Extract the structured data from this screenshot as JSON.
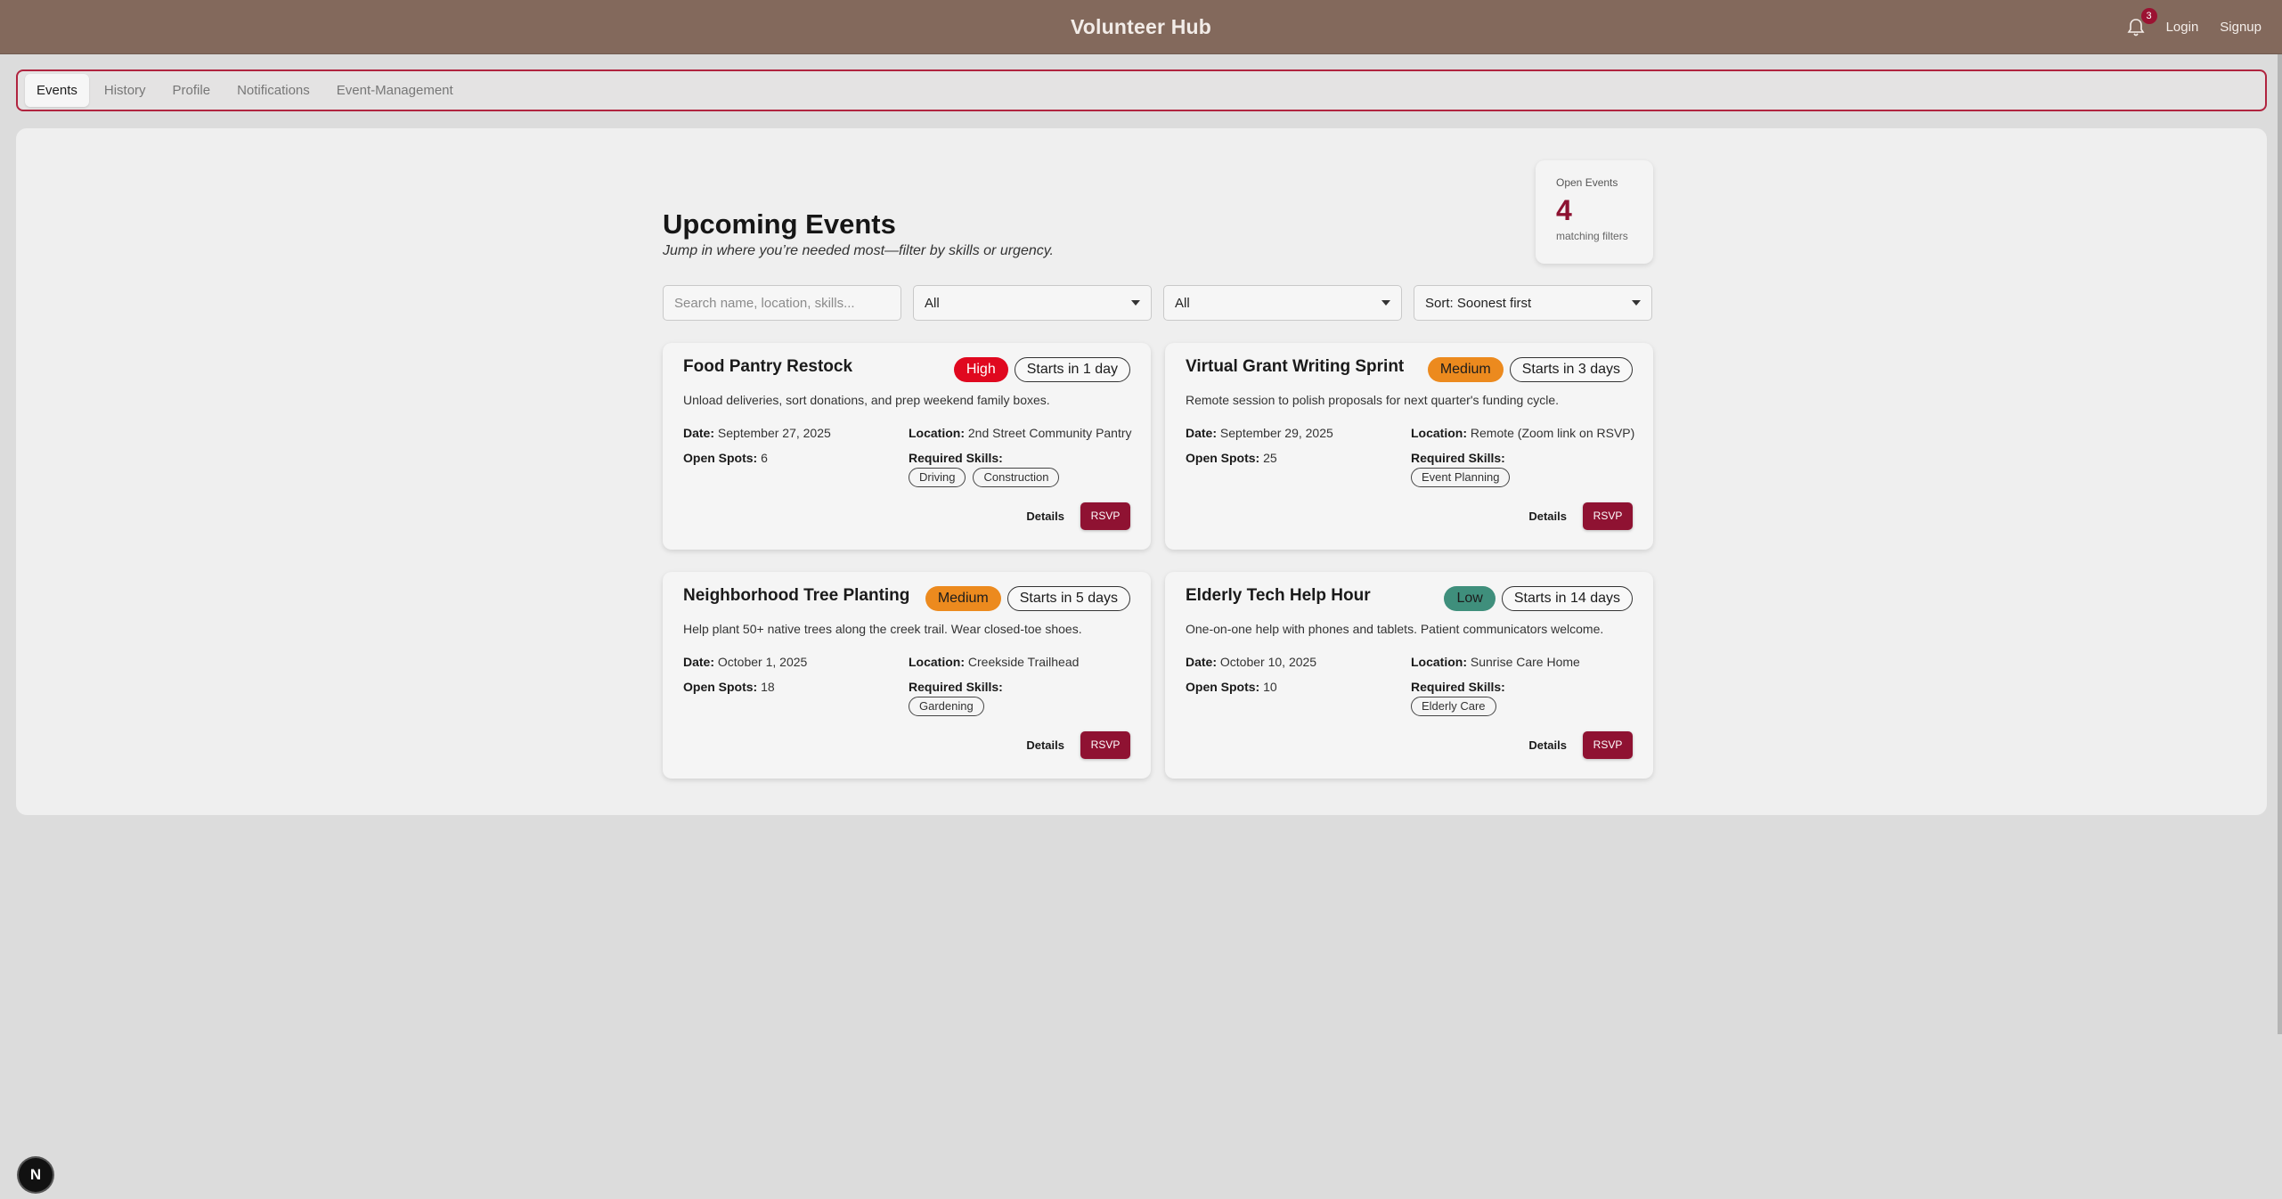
{
  "header": {
    "title": "Volunteer Hub",
    "notification_count": "3",
    "login_label": "Login",
    "signup_label": "Signup"
  },
  "tabs": [
    {
      "label": "Events",
      "active": true
    },
    {
      "label": "History",
      "active": false
    },
    {
      "label": "Profile",
      "active": false
    },
    {
      "label": "Notifications",
      "active": false
    },
    {
      "label": "Event-Management",
      "active": false
    }
  ],
  "main": {
    "title": "Upcoming Events",
    "subtitle": "Jump in where you’re needed most—filter by skills or urgency.",
    "stat": {
      "label": "Open Events",
      "value": "4",
      "sublabel": "matching filters"
    },
    "filters": {
      "search_placeholder": "Search name, location, skills...",
      "filter1_value": "All",
      "filter2_value": "All",
      "sort_value": "Sort: Soonest first"
    },
    "labels": {
      "date": "Date:",
      "location": "Location:",
      "open_spots": "Open Spots:",
      "required_skills": "Required Skills:",
      "details": "Details",
      "rsvp": "RSVP"
    },
    "events": [
      {
        "title": "Food Pantry Restock",
        "urgency": "High",
        "urgency_color": "#e0081f",
        "starts": "Starts in 1 day",
        "description": "Unload deliveries, sort donations, and prep weekend family boxes.",
        "date": "September 27, 2025",
        "location": "2nd Street Community Pantry",
        "open_spots": "6",
        "skills": [
          "Driving",
          "Construction"
        ]
      },
      {
        "title": "Virtual Grant Writing Sprint",
        "urgency": "Medium",
        "urgency_color": "#ec8a1e",
        "starts": "Starts in 3 days",
        "description": "Remote session to polish proposals for next quarter's funding cycle.",
        "date": "September 29, 2025",
        "location": "Remote (Zoom link on RSVP)",
        "open_spots": "25",
        "skills": [
          "Event Planning"
        ]
      },
      {
        "title": "Neighborhood Tree Planting",
        "urgency": "Medium",
        "urgency_color": "#ec8a1e",
        "starts": "Starts in 5 days",
        "description": "Help plant 50+ native trees along the creek trail. Wear closed-toe shoes.",
        "date": "October 1, 2025",
        "location": "Creekside Trailhead",
        "open_spots": "18",
        "skills": [
          "Gardening"
        ]
      },
      {
        "title": "Elderly Tech Help Hour",
        "urgency": "Low",
        "urgency_color": "#3f8f7c",
        "starts": "Starts in 14 days",
        "description": "One-on-one help with phones and tablets. Patient communicators welcome.",
        "date": "October 10, 2025",
        "location": "Sunrise Care Home",
        "open_spots": "10",
        "skills": [
          "Elderly Care"
        ]
      }
    ]
  },
  "fab_label": "N",
  "colors": {
    "header_bg": "#83695c",
    "accent": "#8f1232",
    "tab_border": "#b0243f"
  }
}
